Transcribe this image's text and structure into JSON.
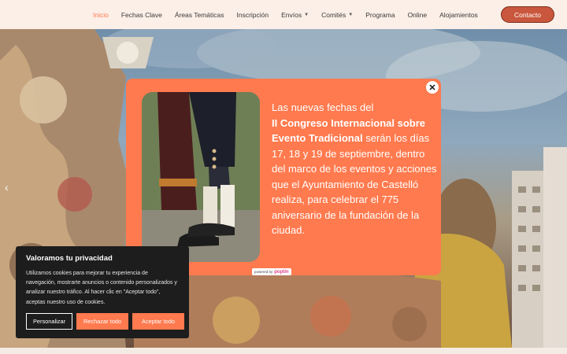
{
  "nav": {
    "items": [
      {
        "label": "Inicio",
        "active": true,
        "dropdown": false
      },
      {
        "label": "Fechas Clave",
        "active": false,
        "dropdown": false
      },
      {
        "label": "Áreas Temáticas",
        "active": false,
        "dropdown": false
      },
      {
        "label": "Inscripción",
        "active": false,
        "dropdown": false
      },
      {
        "label": "Envíos",
        "active": false,
        "dropdown": true
      },
      {
        "label": "Comités",
        "active": false,
        "dropdown": true
      },
      {
        "label": "Programa",
        "active": false,
        "dropdown": false
      },
      {
        "label": "Online",
        "active": false,
        "dropdown": false
      },
      {
        "label": "Alojamientos",
        "active": false,
        "dropdown": false
      }
    ],
    "contact_label": "Contacto",
    "active_color": "#ff7a4e"
  },
  "hero": {
    "prev_arrow": "‹"
  },
  "popup": {
    "close_glyph": "✕",
    "text_intro": "Las nuevas fechas del",
    "text_highlight": "II Congreso Internacional sobre Evento Tradicional",
    "text_rest": "serán los días 17, 18 y 19 de septiembre, dentro del marco de los eventos y acciones que el Ayuntamiento de Castelló realiza, para celebrar el 775 aniversario de la fundación de la ciudad.",
    "powered_by": "powered by",
    "powered_brand": "poptin",
    "background_color": "#ff7a4e"
  },
  "cookie": {
    "title": "Valoramos tu privacidad",
    "body": "Utilizamos cookies para mejorar tu experiencia de navegación, mostrarte anuncios o contenido personalizados y analizar nuestro tráfico. Al hacer clic en \"Aceptar todo\", aceptas nuestro uso de cookies.",
    "personalize_label": "Personalizar",
    "reject_label": "Rechazar todo",
    "accept_label": "Aceptar todo"
  }
}
